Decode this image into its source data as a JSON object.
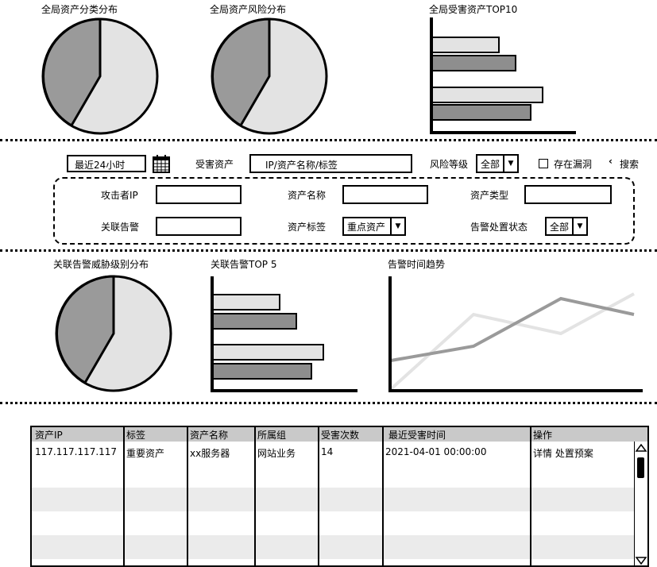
{
  "charts_top": {
    "asset_category": {
      "title": "全局资产分类分布"
    },
    "asset_risk": {
      "title": "全局资产风险分布"
    },
    "top10": {
      "title": "全局受害资产TOP10"
    }
  },
  "filters": {
    "time_range": "最近24小时",
    "victim_asset_label": "受害资产",
    "victim_asset_placeholder": "IP/资产名称/标签",
    "risk_level_label": "风险等级",
    "risk_level_value": "全部",
    "has_vuln_label": "存在漏洞",
    "search_label": "搜索",
    "attacker_ip_label": "攻击者IP",
    "asset_name_label": "资产名称",
    "asset_type_label": "资产类型",
    "related_alert_label": "关联告警",
    "asset_tag_label": "资产标签",
    "asset_tag_value": "重点资产",
    "alert_status_label": "告警处置状态",
    "alert_status_value": "全部"
  },
  "charts_mid": {
    "threat_level": {
      "title": "关联告警威胁级别分布"
    },
    "top5": {
      "title": "关联告警TOP 5"
    },
    "trend": {
      "title": "告警时间趋势"
    }
  },
  "table": {
    "headers": [
      "资产IP",
      "标签",
      "资产名称",
      "所属组",
      "受害次数",
      "最近受害时间",
      "操作"
    ],
    "rows": [
      [
        "117.117.117.117",
        "重要资产",
        "xx服务器",
        "网站业务",
        "14",
        "2021-04-01 00:00:00",
        "详情 处置预案"
      ]
    ]
  },
  "colors": {
    "dark_gray": "#9a9a9a",
    "light_gray": "#e3e3e3",
    "mid_gray": "#8e8e8e",
    "header_gray": "#c9c9c9"
  }
}
